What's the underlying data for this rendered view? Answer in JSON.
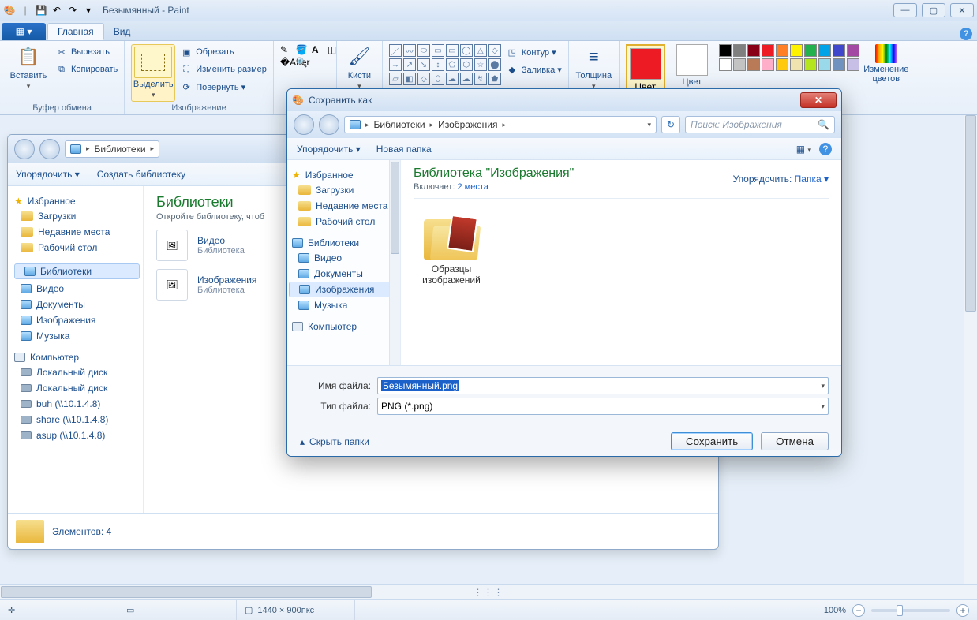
{
  "window": {
    "title": "Безымянный - Paint",
    "qat_glyphs": {
      "save": "💾",
      "undo": "↶",
      "redo": "↷",
      "dd": "▾"
    }
  },
  "tabs": {
    "file_glyph": "▦ ▾",
    "home": "Главная",
    "view": "Вид"
  },
  "ribbon": {
    "clipboard": {
      "paste": "Вставить",
      "cut": "Вырезать",
      "copy": "Копировать",
      "group": "Буфер обмена"
    },
    "image": {
      "select": "Выделить",
      "crop": "Обрезать",
      "resize": "Изменить размер",
      "rotate": "Повернуть ▾",
      "group": "Изображение"
    },
    "tools": {
      "group": "",
      "brush": "Кисти"
    },
    "shapes": {
      "outline": "Контур ▾",
      "fill": "Заливка ▾",
      "group": "",
      "glyphs": [
        "／",
        "〰",
        "⬭",
        "▭",
        "▭",
        "◯",
        "△",
        "◇",
        "→",
        "↗",
        "↘",
        "↕",
        "⬠",
        "⬡",
        "☆",
        "⬤",
        "▱",
        "◧",
        "◇",
        "⬯",
        "☁",
        "☁",
        "↯",
        "⬟"
      ]
    },
    "size": {
      "label": "Толщина"
    },
    "colors": {
      "color1": "Цвет",
      "color2": "Цвет",
      "edit": "Изменение\nцветов",
      "primary": "#ed1c24",
      "palette": [
        "#000000",
        "#7f7f7f",
        "#880015",
        "#ed1c24",
        "#ff7f27",
        "#fff200",
        "#22b14c",
        "#00a2e8",
        "#3f48cc",
        "#a349a4",
        "#ffffff",
        "#c3c3c3",
        "#b97a57",
        "#ffaec9",
        "#ffc90e",
        "#efe4b0",
        "#b5e61d",
        "#99d9ea",
        "#7092be",
        "#c8bfe7"
      ]
    }
  },
  "explorer_bg": {
    "crumb": "Библиотеки",
    "toolbar": {
      "organize": "Упорядочить ▾",
      "newlib": "Создать библиотеку"
    },
    "side": {
      "fav": "Избранное",
      "fav_items": [
        "Загрузки",
        "Недавние места",
        "Рабочий стол"
      ],
      "libs": "Библиотеки",
      "lib_items": [
        "Видео",
        "Документы",
        "Изображения",
        "Музыка"
      ],
      "pc": "Компьютер",
      "pc_items": [
        "Локальный диск",
        "Локальный диск",
        "buh (\\\\10.1.4.8)",
        "share (\\\\10.1.4.8)",
        "asup (\\\\10.1.4.8)"
      ]
    },
    "main": {
      "title": "Библиотеки",
      "sub": "Откройте библиотеку, чтоб",
      "items": [
        {
          "name": "Видео",
          "type": "Библиотека"
        },
        {
          "name": "Изображения",
          "type": "Библиотека"
        }
      ]
    },
    "status": "Элементов: 4"
  },
  "dialog": {
    "title": "Сохранить как",
    "crumb_parts": [
      "Библиотеки",
      "Изображения"
    ],
    "search_placeholder": "Поиск: Изображения",
    "tools": {
      "organize": "Упорядочить ▾",
      "newfolder": "Новая папка"
    },
    "side": {
      "fav": "Избранное",
      "fav_items": [
        "Загрузки",
        "Недавние места",
        "Рабочий стол"
      ],
      "libs": "Библиотеки",
      "lib_items": [
        "Видео",
        "Документы",
        "Изображения",
        "Музыка"
      ],
      "pc": "Компьютер"
    },
    "main": {
      "title": "Библиотека \"Изображения\"",
      "includes_label": "Включает:",
      "includes_link": "2 места",
      "sort_label": "Упорядочить:",
      "sort_value": "Папка ▾",
      "folder_name": "Образцы\nизображений"
    },
    "fields": {
      "name_label": "Имя файла:",
      "name_value": "Безымянный.png",
      "type_label": "Тип файла:",
      "type_value": "PNG (*.png)"
    },
    "buttons": {
      "hide": "Скрыть папки",
      "save": "Сохранить",
      "cancel": "Отмена"
    }
  },
  "status": {
    "dims_label": "1440 × 900пкс",
    "zoom": "100%"
  }
}
